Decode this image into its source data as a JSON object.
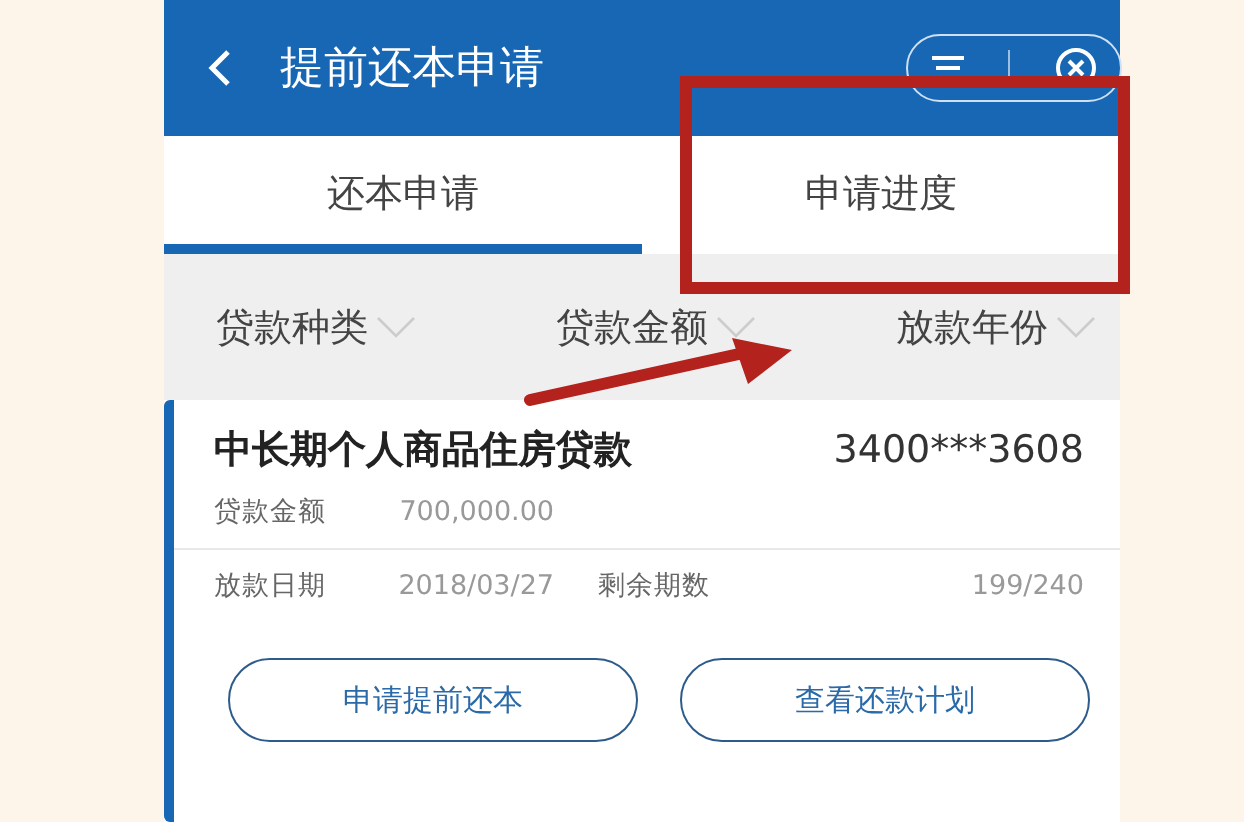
{
  "header": {
    "title": "提前还本申请"
  },
  "tabs": [
    {
      "label": "还本申请",
      "selected": true
    },
    {
      "label": "申请进度",
      "selected": false
    }
  ],
  "filters": [
    {
      "label": "贷款种类"
    },
    {
      "label": "贷款金额"
    },
    {
      "label": "放款年份"
    }
  ],
  "loan": {
    "name": "中长期个人商品住房贷款",
    "account": "3400***3608",
    "fields": [
      {
        "label": "贷款金额",
        "value": "700,000.00"
      },
      {
        "label": "放款日期",
        "value": "2018/03/27"
      },
      {
        "label": "剩余期数",
        "value": "199/240"
      }
    ],
    "buttons": [
      {
        "label": "申请提前还本"
      },
      {
        "label": "查看还款计划"
      }
    ]
  }
}
